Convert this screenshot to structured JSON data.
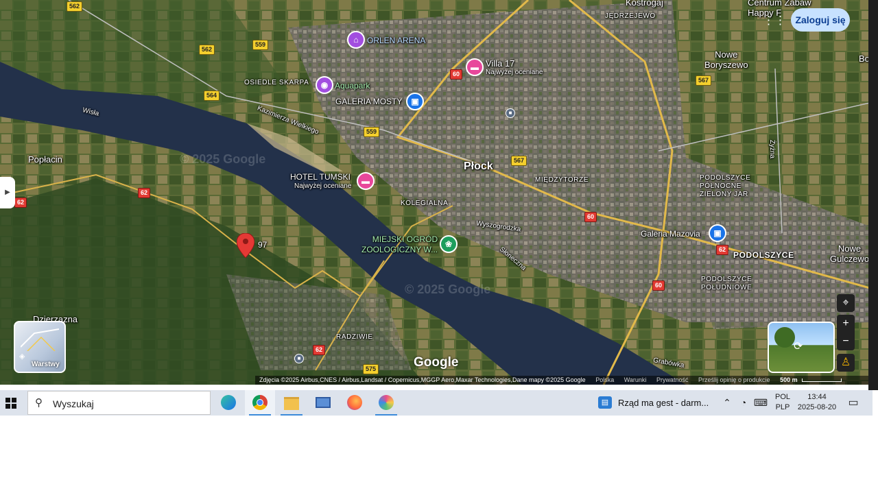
{
  "map": {
    "labels": {
      "plock": "Płock",
      "poplacin": "Popłacin",
      "dzierzazna": "Dzierzązna",
      "nowe_boryszewo": "Nowe\nBoryszewo",
      "nowe_gulczewo": "Nowe\nGulczewo",
      "miedzytorze": "MIĘDZYTORZE",
      "kolegialna": "KOLEGIALNA",
      "osiedle_skarpa": "OSIEDLE SKARPA",
      "podolszyce": "PODOLSZYCE",
      "podolszyce_polnocne": "PODOLSZYCE\nPÓŁNOCNE\nZIELONY JAR",
      "podolszyce_poludniowe": "PODOLSZYCE\nPOŁUDNIOWE",
      "radziwie": "RADZIWIE",
      "jedrzejewo": "JĘDRZEJEWO",
      "kostrogaj": "Kostrogaj",
      "centrum_zabaw": "Centrum Zabaw\nHappy F",
      "bo": "Bo",
      "wisla": "Wisła",
      "kazimierza": "Kazimierza Wielkiego",
      "wyszogrodzka": "Wyszogrodzka",
      "sloneczna": "Słoneczna",
      "zyzna": "Żyżna",
      "grabowka": "Grabówka",
      "pin_number": "97"
    },
    "pois": {
      "orlen_arena": "ORLEN ARENA",
      "villa17": "Villa 17",
      "villa17_sub": "Najwyżej oceniane",
      "aquapark": "Aquapark",
      "galeria_mosty": "GALERIA MOSTY",
      "hotel_tumski": "HOTEL TUMSKI",
      "hotel_tumski_sub": "Najwyżej oceniane",
      "zoo": "MIEJSKI OGRÓD\nZOOLOGICZNY W...",
      "galeria_mazovia": "Galeria Mazovia"
    },
    "road_shields": {
      "r562a": "562",
      "r562b": "562",
      "r559a": "559",
      "r559b": "559",
      "r564": "564",
      "r567a": "567",
      "r567b": "567",
      "r575": "575",
      "r60a": "60",
      "r60b": "60",
      "r60c": "60",
      "r62a": "62",
      "r62b": "62",
      "r62c": "62",
      "r62d": "62"
    },
    "watermark": "© 2025 Google",
    "layers_label": "Warstwy",
    "login_label": "Zaloguj się",
    "google_logo": "Google",
    "attribution": {
      "imagery": "Zdjęcia ©2025 Airbus,CNES / Airbus,Landsat / Copernicus,MGGP Aero,Maxar Technologies,Dane mapy ©2025 Google",
      "country": "Polska",
      "terms": "Warunki",
      "privacy": "Prywatność",
      "feedback": "Prześlij opinię o produkcie",
      "scale": "500 m"
    },
    "controls": {
      "zoom_in": "+",
      "zoom_out": "−"
    }
  },
  "taskbar": {
    "search_placeholder": "Wyszukaj",
    "news_text": "Rząd ma gest - darm...",
    "lang_top": "POL",
    "lang_bottom": "PLP",
    "time": "13:44",
    "date": "2025-08-20",
    "apps": [
      "edge-icon",
      "chrome-icon",
      "file-explorer-icon",
      "network-app-icon",
      "firefox-icon",
      "paint-icon"
    ],
    "active_app": "chrome-icon"
  }
}
